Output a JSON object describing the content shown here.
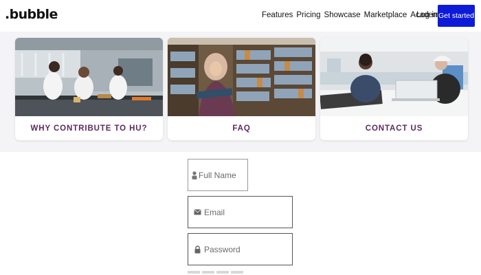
{
  "header": {
    "logo": ".bubble",
    "nav": [
      "Features",
      "Pricing",
      "Showcase",
      "Marketplace",
      "Academy"
    ],
    "login": "Log in",
    "cta": "Get started",
    "cta_color": "#0d1bd9"
  },
  "cards": [
    {
      "caption": "WHY CONTRIBUTE TO HU?",
      "icon": "lab-photo"
    },
    {
      "caption": "FAQ",
      "icon": "library-photo"
    },
    {
      "caption": "CONTACT US",
      "icon": "students-photo"
    }
  ],
  "card_caption_color": "#5b2a62",
  "form": {
    "fullname_placeholder": "Full Name",
    "email_placeholder": "Email",
    "password_placeholder": "Password"
  }
}
